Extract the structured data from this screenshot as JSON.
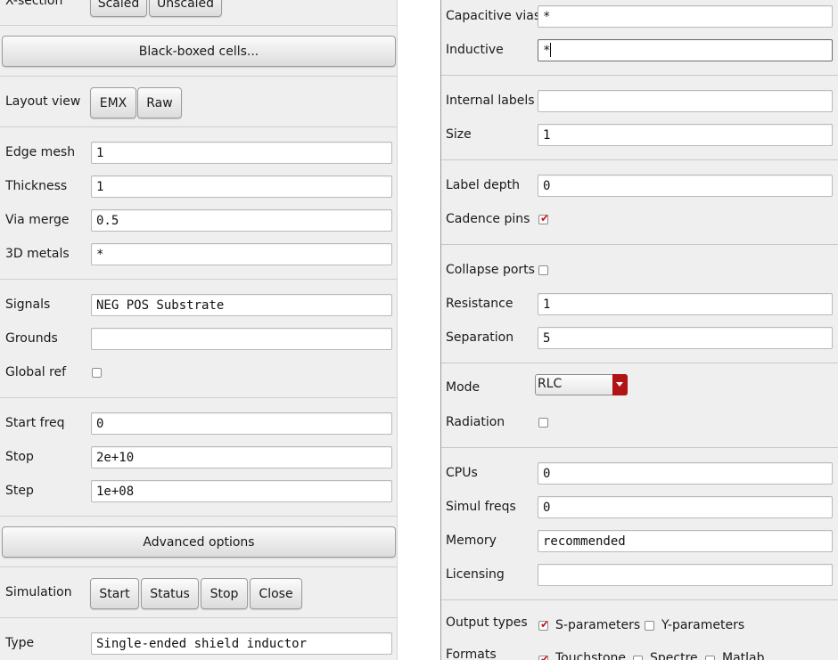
{
  "left": {
    "xsection": {
      "label": "X-section",
      "scaled": "Scaled",
      "unscaled": "Unscaled"
    },
    "blackboxed_button": "Black-boxed cells...",
    "layout_view": {
      "label": "Layout view",
      "emx": "EMX",
      "raw": "Raw"
    },
    "edge_mesh": {
      "label": "Edge mesh",
      "value": "1"
    },
    "thickness": {
      "label": "Thickness",
      "value": "1"
    },
    "via_merge": {
      "label": "Via merge",
      "value": "0.5"
    },
    "metals_3d": {
      "label": "3D metals",
      "value": "*"
    },
    "signals": {
      "label": "Signals",
      "value": "NEG POS Substrate"
    },
    "grounds": {
      "label": "Grounds",
      "value": ""
    },
    "global_ref": {
      "label": "Global ref",
      "checked": false
    },
    "start_freq": {
      "label": "Start freq",
      "value": "0"
    },
    "stop": {
      "label": "Stop",
      "value": "2e+10"
    },
    "step": {
      "label": "Step",
      "value": "1e+08"
    },
    "advanced_button": "Advanced options",
    "simulation": {
      "label": "Simulation",
      "start": "Start",
      "status": "Status",
      "stop": "Stop",
      "close": "Close"
    },
    "type": {
      "label": "Type",
      "value": "Single-ended shield inductor"
    }
  },
  "right": {
    "capacitive_vias": {
      "label": "Capacitive vias",
      "value": "*"
    },
    "inductive": {
      "label": "Inductive",
      "value": "*"
    },
    "internal_labels": {
      "label": "Internal labels",
      "value": ""
    },
    "size": {
      "label": "Size",
      "value": "1"
    },
    "label_depth": {
      "label": "Label depth",
      "value": "0"
    },
    "cadence_pins": {
      "label": "Cadence pins",
      "checked": true
    },
    "collapse_ports": {
      "label": "Collapse ports",
      "checked": false
    },
    "resistance": {
      "label": "Resistance",
      "value": "1"
    },
    "separation": {
      "label": "Separation",
      "value": "5"
    },
    "mode": {
      "label": "Mode",
      "value": "RLC"
    },
    "radiation": {
      "label": "Radiation",
      "checked": false
    },
    "cpus": {
      "label": "CPUs",
      "value": "0"
    },
    "simul_freqs": {
      "label": "Simul freqs",
      "value": "0"
    },
    "memory": {
      "label": "Memory",
      "value": "recommended"
    },
    "licensing": {
      "label": "Licensing",
      "value": ""
    },
    "output_types": {
      "label": "Output types",
      "s_params": "S-parameters",
      "y_params": "Y-parameters"
    },
    "formats": {
      "label": "Formats",
      "touchstone": "Touchstone",
      "spectre": "Spectre",
      "matlab": "Matlab"
    }
  },
  "colors": {
    "panel_bg": "#efefef",
    "accent_red": "#b21313",
    "check_red": "#c8141e"
  }
}
